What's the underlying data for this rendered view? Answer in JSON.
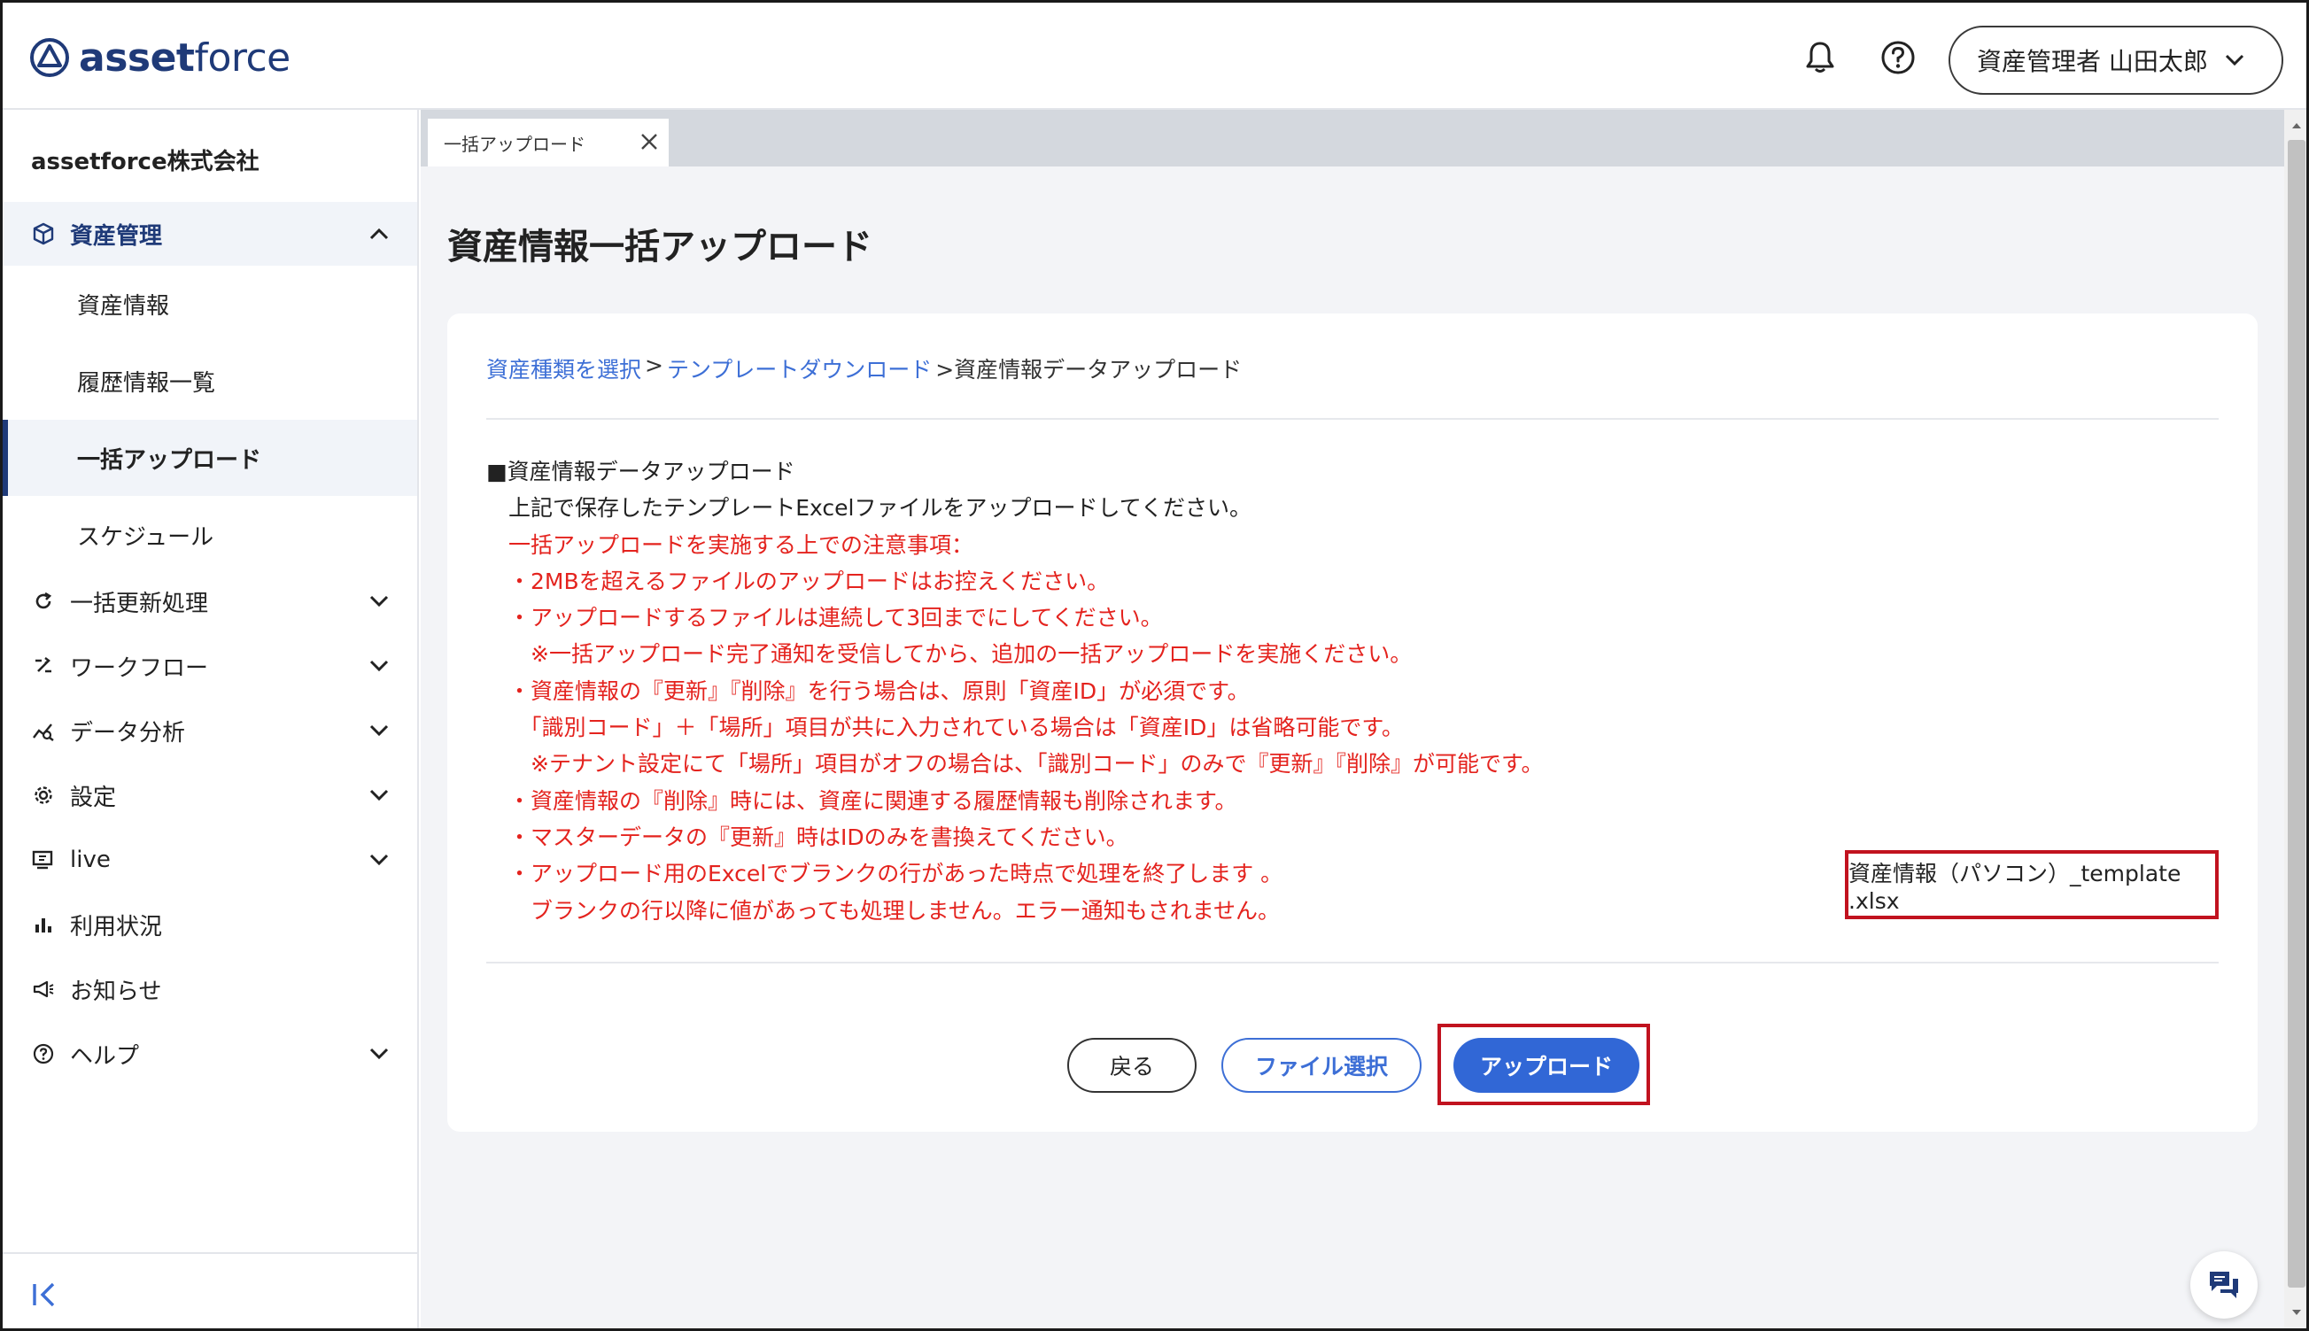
{
  "header": {
    "logo_bold": "asset",
    "logo_light": "force",
    "user_label": "資産管理者 山田太郎"
  },
  "sidebar": {
    "company": "assetforce株式会社",
    "group_open": {
      "label": "資産管理",
      "icon": "cube-icon"
    },
    "sub_items": [
      {
        "label": "資産情報",
        "active": false
      },
      {
        "label": "履歴情報一覧",
        "active": false
      },
      {
        "label": "一括アップロード",
        "active": true
      },
      {
        "label": "スケジュール",
        "active": false
      }
    ],
    "items": [
      {
        "label": "一括更新処理",
        "icon": "refresh-icon",
        "expandable": true
      },
      {
        "label": "ワークフロー",
        "icon": "workflow-icon",
        "expandable": true
      },
      {
        "label": "データ分析",
        "icon": "analytics-icon",
        "expandable": true
      },
      {
        "label": "設定",
        "icon": "gear-icon",
        "expandable": true
      },
      {
        "label": "live",
        "icon": "live-icon",
        "expandable": true
      },
      {
        "label": "利用状況",
        "icon": "bar-chart-icon",
        "expandable": false
      },
      {
        "label": "お知らせ",
        "icon": "megaphone-icon",
        "expandable": false
      },
      {
        "label": "ヘルプ",
        "icon": "help-icon",
        "expandable": true
      }
    ]
  },
  "tab": {
    "label": "一括アップロード"
  },
  "page": {
    "title": "資産情報一括アップロード",
    "breadcrumb": {
      "step1": "資産種類を選択",
      "sep1": " > ",
      "step2": "テンプレートダウンロード",
      "current": " >資産情報データアップロード"
    },
    "notes": {
      "heading": "■資産情報データアップロード",
      "intro": "　上記で保存したテンプレートExcelファイルをアップロードしてください。",
      "caution_title": "　一括アップロードを実施する上での注意事項：",
      "lines": [
        "　・2MBを超えるファイルのアップロードはお控えください。",
        "　・アップロードするファイルは連続して3回までにしてください。",
        "　　※一括アップロード完了通知を受信してから、追加の一括アップロードを実施ください。",
        "　・資産情報の『更新』『削除』を行う場合は、原則「資産ID」が必須です。",
        "　　「識別コード」＋「場所」項目が共に入力されている場合は「資産ID」は省略可能です。",
        "　　※テナント設定にて「場所」項目がオフの場合は、「識別コード」のみで『更新』『削除』が可能です。",
        "　・資産情報の『削除』時には、資産に関連する履歴情報も削除されます。",
        "　・マスターデータの『更新』時はIDのみを書換えてください。",
        "　・アップロード用のExcelでブランクの行があった時点で処理を終了します 。",
        "　　ブランクの行以降に値があっても処理しません。エラー通知もされません。"
      ]
    },
    "selected_file": "資産情報（パソコン）_template .xlsx",
    "buttons": {
      "back": "戻る",
      "file_select": "ファイル選択",
      "upload": "アップロード"
    }
  },
  "colors": {
    "brand": "#1f3a78",
    "link": "#3d6fd6",
    "primary": "#3167d6",
    "warning_text": "#e4231e",
    "highlight_border": "#c1121f"
  }
}
